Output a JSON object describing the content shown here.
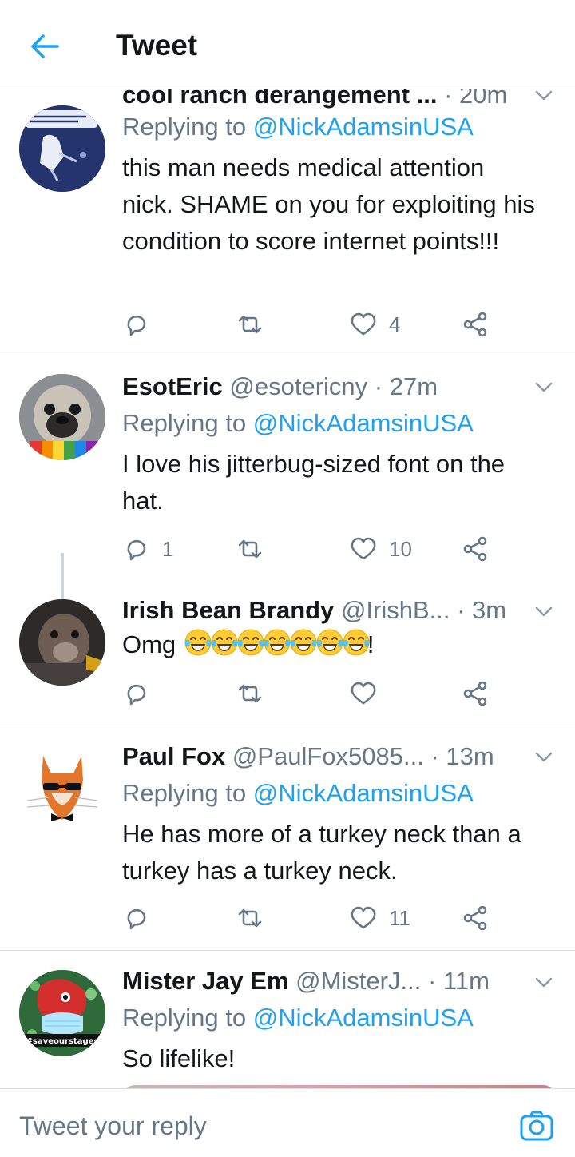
{
  "header": {
    "title": "Tweet",
    "back_icon": "arrow-left-icon",
    "accent": "#1da1f2"
  },
  "tweets": [
    {
      "name": "cool ranch derangement ...",
      "handle": "",
      "time": "· 20m",
      "replying_prefix": "Replying to ",
      "replying_handle": "@NickAdamsinUSA",
      "text": "this man needs medical attention nick. SHAME on you for exploiting his condition to score internet points!!!",
      "reply_count": "",
      "retweet_count": "",
      "like_count": "4"
    },
    {
      "name": "EsotEric",
      "handle": "@esotericny",
      "time": "· 27m",
      "replying_prefix": "Replying to ",
      "replying_handle": "@NickAdamsinUSA",
      "text": "I love his jitterbug-sized font on the hat.",
      "reply_count": "1",
      "retweet_count": "",
      "like_count": "10"
    },
    {
      "name": "Irish Bean Brandy",
      "handle": "@IrishB...",
      "time": "· 3m",
      "text": "Omg",
      "text_suffix": "!",
      "emoji_name": "face-with-tears-of-joy-icon",
      "emoji_count": 7,
      "reply_count": "",
      "retweet_count": "",
      "like_count": ""
    },
    {
      "name": "Paul Fox",
      "handle": "@PaulFox5085...",
      "time": "· 13m",
      "replying_prefix": "Replying to ",
      "replying_handle": "@NickAdamsinUSA",
      "text": "He has more of a turkey neck than a turkey has a turkey neck.",
      "reply_count": "",
      "retweet_count": "",
      "like_count": "11"
    },
    {
      "name": "Mister Jay Em",
      "handle": "@MisterJ...",
      "time": "· 11m",
      "replying_prefix": "Replying to ",
      "replying_handle": "@NickAdamsinUSA",
      "text": "So lifelike!",
      "avatar_text": "#saveourstages"
    }
  ],
  "composer": {
    "placeholder": "Tweet your reply",
    "camera_icon": "camera-icon"
  }
}
